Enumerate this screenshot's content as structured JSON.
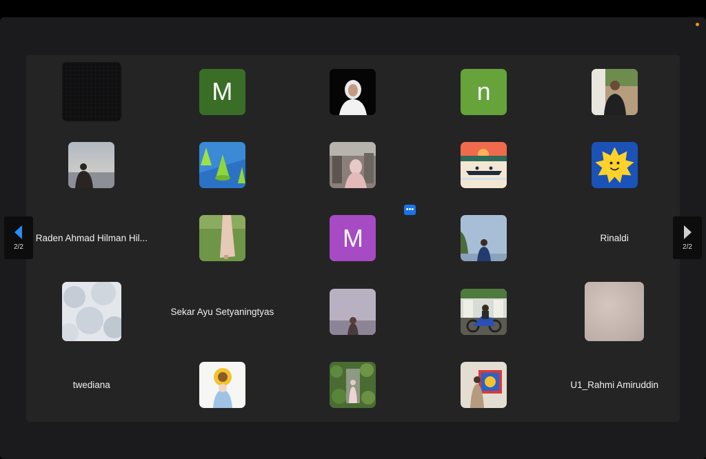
{
  "page": {
    "current": 2,
    "total": 2,
    "indicator": "2/2"
  },
  "more_button": {
    "label": "•••"
  },
  "colors": {
    "accent": "#1a74e8",
    "background": "#1b1b1d",
    "tile_area": "#242424"
  },
  "participants": [
    {
      "kind": "photo",
      "style": "dark-grid",
      "size": "big"
    },
    {
      "kind": "letter",
      "letter": "M",
      "bg": "#3a6e26"
    },
    {
      "kind": "photo",
      "style": "hijab-black"
    },
    {
      "kind": "letter",
      "letter": "n",
      "bg": "#66a33b"
    },
    {
      "kind": "photo",
      "style": "man-outdoor"
    },
    {
      "kind": "photo",
      "style": "sea-silhouette"
    },
    {
      "kind": "photo",
      "style": "green-cones"
    },
    {
      "kind": "photo",
      "style": "street-hijab"
    },
    {
      "kind": "photo",
      "style": "sunset-boat"
    },
    {
      "kind": "photo",
      "style": "sun-cartoon"
    },
    {
      "kind": "name",
      "name": "Raden Ahmad Hilman Hil..."
    },
    {
      "kind": "photo",
      "style": "grass-dress"
    },
    {
      "kind": "letter",
      "letter": "M",
      "bg": "#a64bc4"
    },
    {
      "kind": "photo",
      "style": "boy-sky"
    },
    {
      "kind": "name",
      "name": "Rinaldi"
    },
    {
      "kind": "photo",
      "style": "clouds",
      "size": "big"
    },
    {
      "kind": "name",
      "name": "Sekar Ayu Setyaningtyas"
    },
    {
      "kind": "photo",
      "style": "lilac-girl"
    },
    {
      "kind": "photo",
      "style": "motorbike"
    },
    {
      "kind": "photo",
      "style": "blur-pink",
      "size": "big"
    },
    {
      "kind": "name",
      "name": "twediana"
    },
    {
      "kind": "photo",
      "style": "sunflower"
    },
    {
      "kind": "photo",
      "style": "ivy-wall"
    },
    {
      "kind": "photo",
      "style": "art-wall"
    },
    {
      "kind": "name",
      "name": "U1_Rahmi Amiruddin"
    }
  ]
}
